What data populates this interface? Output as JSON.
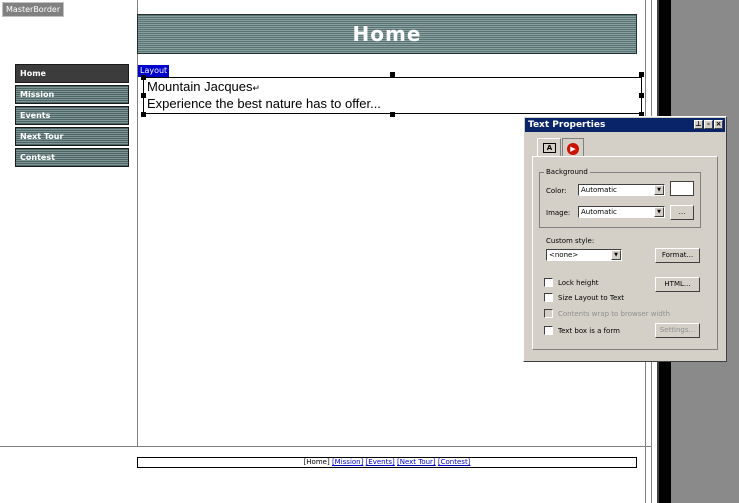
{
  "master_border_label": "MasterBorder",
  "banner": {
    "title": "Home"
  },
  "nav": {
    "items": [
      {
        "label": "Home",
        "active": true
      },
      {
        "label": "Mission"
      },
      {
        "label": "Events"
      },
      {
        "label": "Next Tour"
      },
      {
        "label": "Contest"
      }
    ]
  },
  "layout": {
    "tag": "Layout",
    "line1": "Mountain Jacques",
    "line2": "Experience the best nature has to offer..."
  },
  "footer": {
    "current": "[Home]",
    "links": [
      "[Mission]",
      "[Events]",
      "[Next Tour]",
      "[Contest]"
    ]
  },
  "dialog": {
    "title": "Text Properties",
    "background_group": "Background",
    "color_label": "Color:",
    "color_value": "Automatic",
    "image_label": "Image:",
    "image_value": "Automatic",
    "browse_label": "...",
    "custom_style_label": "Custom style:",
    "custom_style_value": "<none>",
    "format_button": "Format...",
    "html_button": "HTML...",
    "settings_button": "Settings...",
    "lock_height": "Lock height",
    "size_layout": "Size Layout to Text",
    "contents_wrap": "Contents wrap to browser width",
    "text_box_form": "Text box is a form"
  },
  "colors": {
    "banner": "#5a7373",
    "dialog_title": "#0a246a",
    "dialog_bg": "#d4d0c8",
    "link": "#0000cc"
  }
}
